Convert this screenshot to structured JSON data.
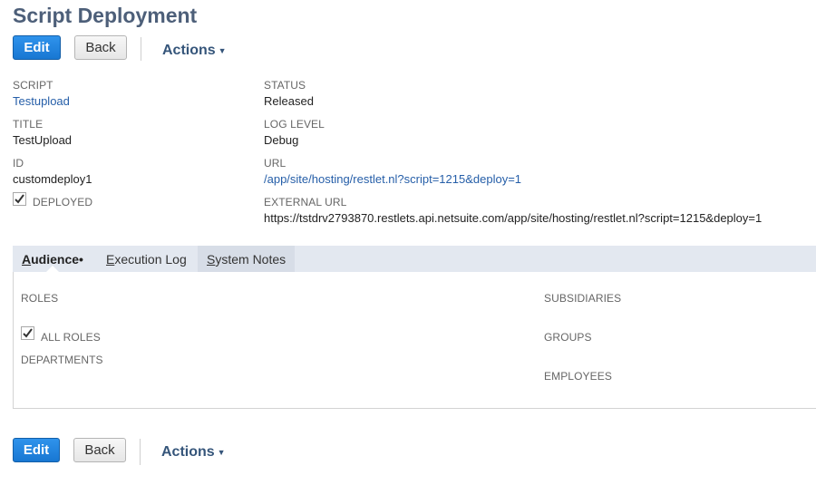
{
  "page": {
    "title": "Script Deployment"
  },
  "toolbar": {
    "edit_label": "Edit",
    "back_label": "Back",
    "actions_label": "Actions"
  },
  "fields": {
    "script": {
      "label": "SCRIPT",
      "value": "Testupload"
    },
    "status": {
      "label": "STATUS",
      "value": "Released"
    },
    "title": {
      "label": "TITLE",
      "value": "TestUpload"
    },
    "log_level": {
      "label": "LOG LEVEL",
      "value": "Debug"
    },
    "id": {
      "label": "ID",
      "value": "customdeploy1"
    },
    "url": {
      "label": "URL",
      "value": "/app/site/hosting/restlet.nl?script=1215&deploy=1"
    },
    "deployed": {
      "label": "DEPLOYED",
      "checked": true
    },
    "external_url": {
      "label": "EXTERNAL URL",
      "value": "https://tstdrv2793870.restlets.api.netsuite.com/app/site/hosting/restlet.nl?script=1215&deploy=1"
    }
  },
  "tabs": [
    {
      "label_first": "A",
      "label_rest": "udience",
      "suffix": " •",
      "active": true
    },
    {
      "label_first": "E",
      "label_rest": "xecution Log",
      "active": false
    },
    {
      "label_first": "S",
      "label_rest": "ystem Notes",
      "active": false
    }
  ],
  "audience": {
    "roles_label": "ROLES",
    "all_roles_label": "ALL ROLES",
    "all_roles_checked": true,
    "departments_label": "DEPARTMENTS",
    "subsidiaries_label": "SUBSIDIARIES",
    "groups_label": "GROUPS",
    "employees_label": "EMPLOYEES"
  },
  "colors": {
    "primary_button": "#1f84e0",
    "title": "#4d5f79",
    "link": "#255ea8",
    "tabbar": "#e3e8f0"
  },
  "icons": {
    "checkbox": "checkmark-icon",
    "actions_caret": "caret-down-icon"
  }
}
